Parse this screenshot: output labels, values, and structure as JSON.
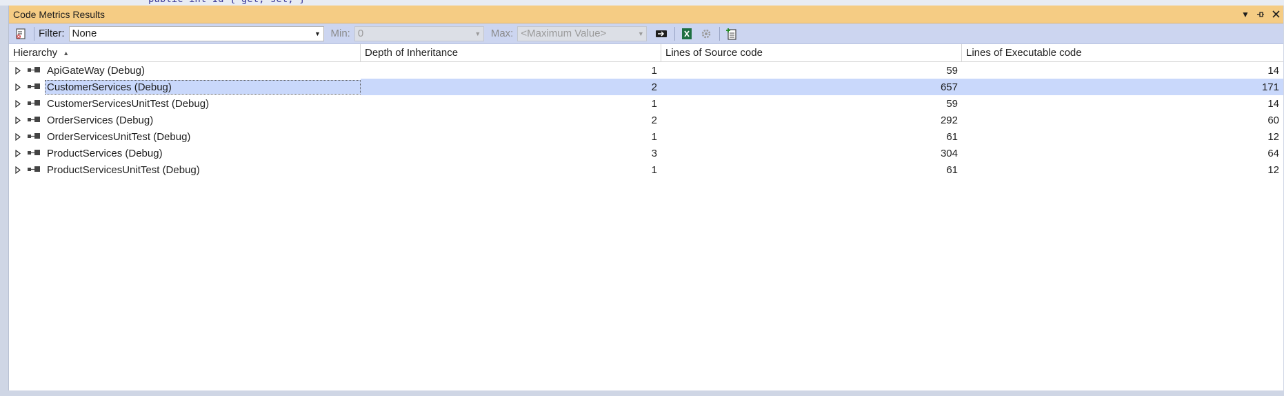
{
  "window": {
    "title": "Code Metrics Results"
  },
  "toolbar": {
    "filter_label": "Filter:",
    "filter_value": "None",
    "min_label": "Min:",
    "min_value": "0",
    "max_label": "Max:",
    "max_placeholder": "<Maximum Value>"
  },
  "columns": [
    "Hierarchy",
    "Depth of Inheritance",
    "Lines of Source code",
    "Lines of Executable code"
  ],
  "sort": {
    "column": "Hierarchy",
    "direction": "ascending"
  },
  "rows": [
    {
      "name": "ApiGateWay (Debug)",
      "depth": "1",
      "source": "59",
      "executable": "14"
    },
    {
      "name": "CustomerServices (Debug)",
      "depth": "2",
      "source": "657",
      "executable": "171"
    },
    {
      "name": "CustomerServicesUnitTest (Debug)",
      "depth": "1",
      "source": "59",
      "executable": "14"
    },
    {
      "name": "OrderServices (Debug)",
      "depth": "2",
      "source": "292",
      "executable": "60"
    },
    {
      "name": "OrderServicesUnitTest (Debug)",
      "depth": "1",
      "source": "61",
      "executable": "12"
    },
    {
      "name": "ProductServices (Debug)",
      "depth": "3",
      "source": "304",
      "executable": "64"
    },
    {
      "name": "ProductServicesUnitTest (Debug)",
      "depth": "1",
      "source": "61",
      "executable": "12"
    }
  ],
  "selected_row": "CustomerServices (Debug)",
  "icons": {
    "calculate": "calculate-metrics-icon",
    "go": "apply-filter-icon",
    "excel": "excel-export-icon",
    "settings": "gear-icon",
    "add_column": "add-column-icon"
  },
  "colors": {
    "titlebar": "#f5cc84",
    "toolbar": "#ccd5f0",
    "selection": "#c9d8fb"
  }
}
